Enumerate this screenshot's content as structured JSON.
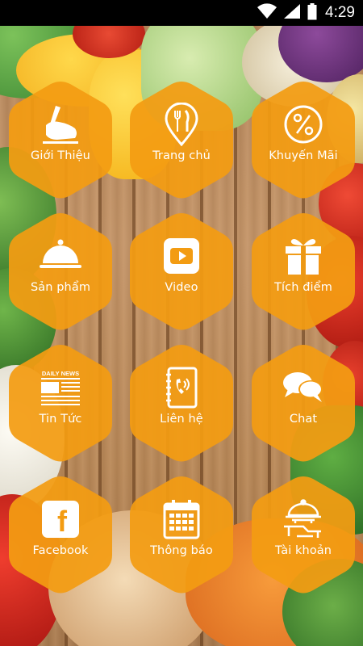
{
  "status_bar": {
    "time": "4:29",
    "icons": [
      "wifi-icon",
      "signal-icon",
      "battery-icon"
    ]
  },
  "theme": {
    "hex_color": "#F39C12",
    "hex_color_alpha": "0.93",
    "label_color": "#FFFFFF"
  },
  "menu": {
    "items": [
      {
        "label": "Giới Thiệu",
        "icon": "hand-writing-icon"
      },
      {
        "label": "Trang chủ",
        "icon": "fork-knife-pin-icon"
      },
      {
        "label": "Khuyến Mãi",
        "icon": "percent-icon"
      },
      {
        "label": "Sản phẩm",
        "icon": "food-cloche-icon"
      },
      {
        "label": "Video",
        "icon": "play-video-icon"
      },
      {
        "label": "Tích điểm",
        "icon": "gift-icon"
      },
      {
        "label": "Tin Tức",
        "icon": "newspaper-icon",
        "icon_text": "DAILY NEWS"
      },
      {
        "label": "Liên hệ",
        "icon": "contact-book-icon"
      },
      {
        "label": "Chat",
        "icon": "chat-bubbles-icon"
      },
      {
        "label": "Facebook",
        "icon": "facebook-icon",
        "icon_text": "f"
      },
      {
        "label": "Thông báo",
        "icon": "calendar-icon"
      },
      {
        "label": "Tài khoản",
        "icon": "waiter-cloche-icon"
      }
    ]
  }
}
